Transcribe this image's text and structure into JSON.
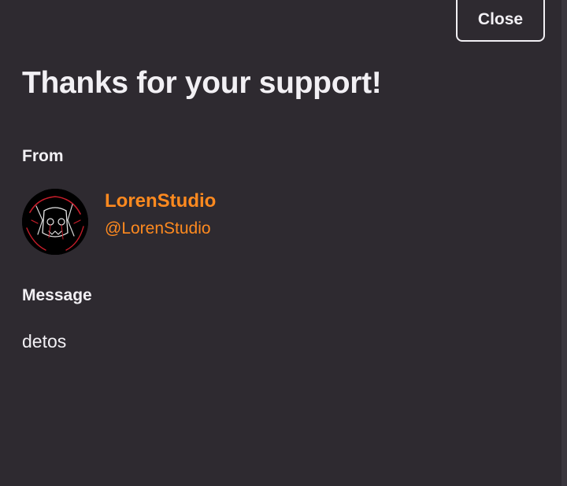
{
  "header": {
    "close_label": "Close"
  },
  "main": {
    "title": "Thanks for your support!",
    "from_label": "From",
    "supporter": {
      "display_name": "LorenStudio",
      "handle": "@LorenStudio",
      "avatar_icon": "user-avatar-icon"
    },
    "message_label": "Message",
    "message_text": "detos"
  },
  "colors": {
    "background": "#2e2a30",
    "text": "#f2f0f4",
    "accent": "#ff8a1f"
  }
}
